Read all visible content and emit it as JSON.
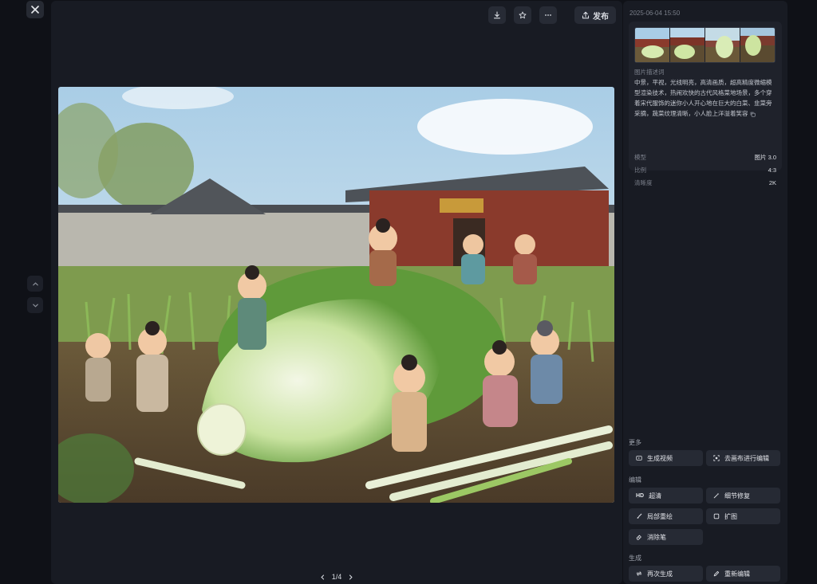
{
  "viewer": {
    "toolbar": {
      "publish_label": "发布"
    },
    "pager": {
      "text": "1/4"
    }
  },
  "panel": {
    "timestamp": "2025-06-04 15:50",
    "prompt_label": "图片描述词",
    "prompt_text": "中景，平视，光线明亮，高清画质，超高精度微缩模型渲染技术，热闹欢快的古代风格菜地场景，多个穿着宋代服饰的迷你小人开心地在巨大的白菜、韭菜旁采摘，蔬菜纹理清晰，小人脸上洋溢着笑容",
    "meta": [
      {
        "key": "模型",
        "value": "图片 3.0"
      },
      {
        "key": "比例",
        "value": "4:3"
      },
      {
        "key": "清晰度",
        "value": "2K"
      }
    ],
    "sections": {
      "more": "更多",
      "edit": "编辑",
      "generate": "生成"
    },
    "actions": {
      "gen_video": "生成视频",
      "canvas_edit": "去画布进行编辑",
      "upscale_prefix": "HD",
      "upscale": "超清",
      "detail_fix": "细节修复",
      "inpaint": "局部重绘",
      "outpaint": "扩图",
      "eraser": "消除笔",
      "regenerate": "再次生成",
      "reedit": "重新编辑"
    }
  },
  "colors": {
    "background": "#0f1117",
    "panel": "#181b23",
    "button": "#262a34"
  }
}
